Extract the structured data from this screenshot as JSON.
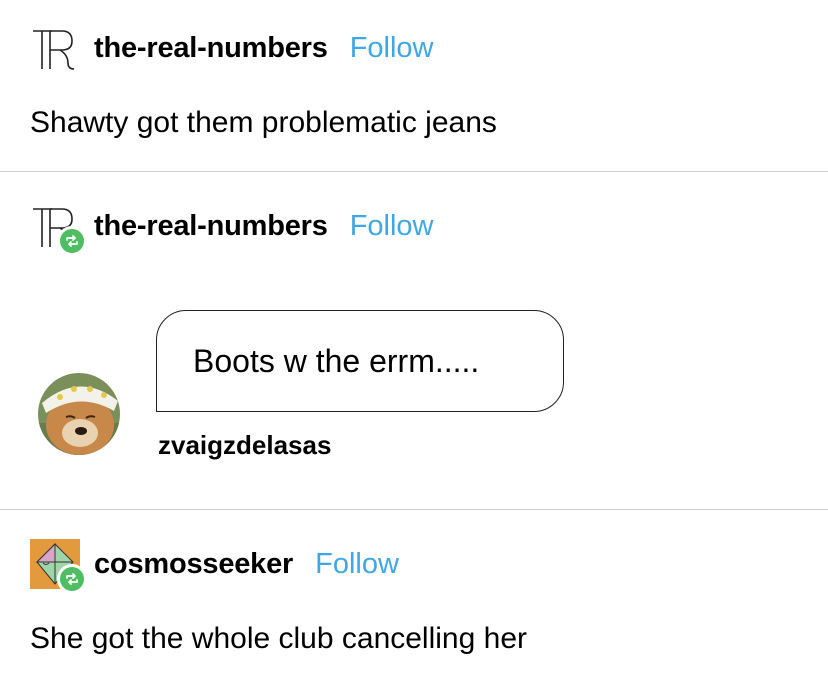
{
  "posts": [
    {
      "username": "the-real-numbers",
      "follow_label": "Follow",
      "text": "Shawty got them problematic jeans",
      "avatar_icon": "tr-monogram-icon"
    },
    {
      "username": "the-real-numbers",
      "follow_label": "Follow",
      "avatar_icon": "tr-monogram-icon",
      "reblogged": true,
      "ask": {
        "question": "Boots w the errm.....",
        "asker": "zvaigzdelasas",
        "asker_avatar_icon": "dog-avatar-icon"
      }
    },
    {
      "username": "cosmosseeker",
      "follow_label": "Follow",
      "text": "She got the whole club cancelling her",
      "avatar_icon": "geometric-avatar-icon",
      "reblogged": true
    }
  ],
  "colors": {
    "follow": "#3fa7e6",
    "reblog_badge": "#50bd62",
    "divider": "#cfcfcf"
  }
}
